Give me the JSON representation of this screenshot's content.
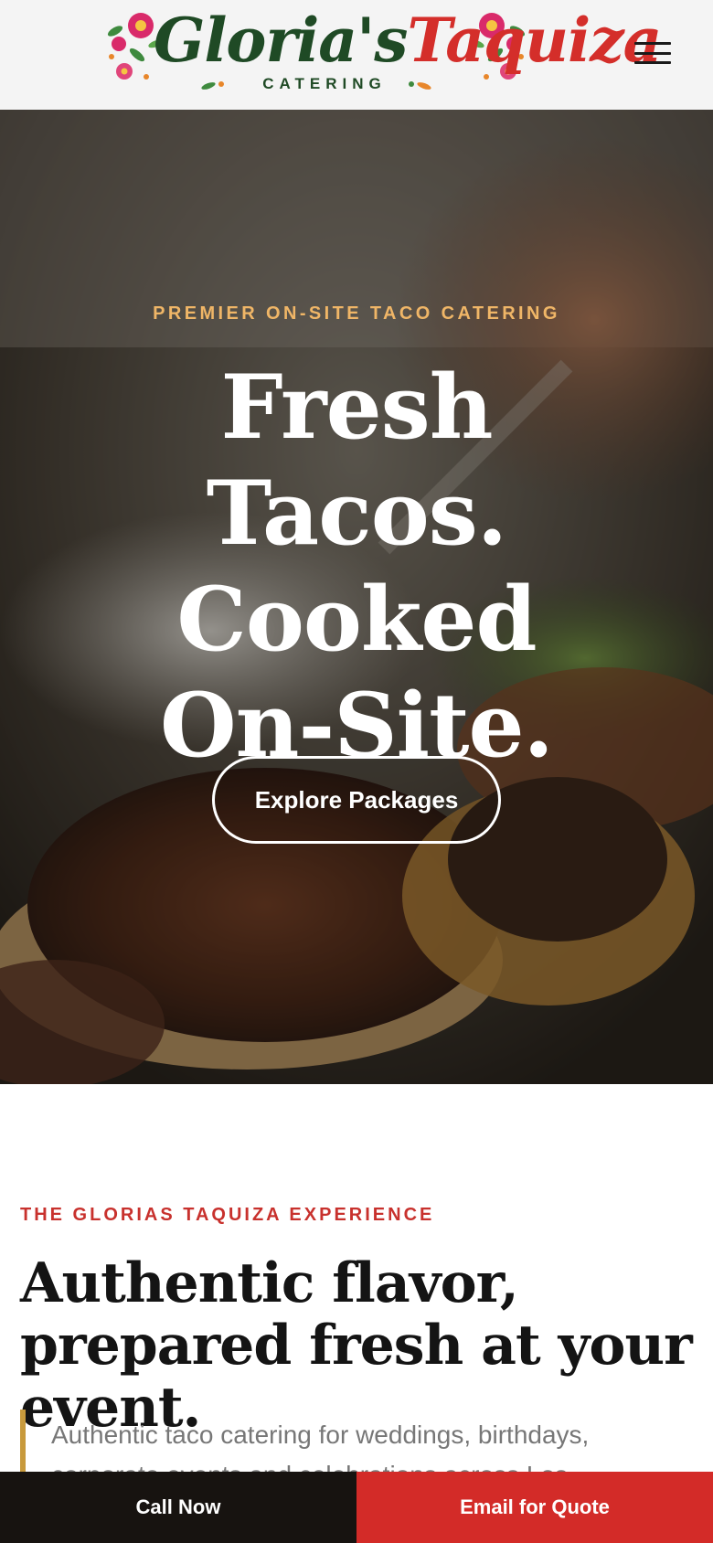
{
  "header": {
    "logo": {
      "name_part1": "Gloria's",
      "name_part2": "Taquiza",
      "subtitle": "CATERING"
    },
    "menu_icon": "hamburger-menu-icon"
  },
  "hero": {
    "eyebrow": "PREMIER ON-SITE TACO CATERING",
    "title": "Fresh Tacos. Cooked On-Site.",
    "cta_label": "Explore Packages"
  },
  "experience": {
    "eyebrow": "THE GLORIAS TAQUIZA EXPERIENCE",
    "heading": "Authentic flavor, prepared fresh at your event.",
    "intro": "Authentic taco catering for weddings, birthdays, corporate events and celebrations across Los"
  },
  "bottom_bar": {
    "call_label": "Call Now",
    "email_label": "Email for Quote"
  },
  "colors": {
    "brand_green": "#1f4a25",
    "brand_red": "#d42e2a",
    "accent_gold": "#f0b667",
    "eyebrow_red": "#c8312d",
    "quote_border": "#c89a3c",
    "bar_dark": "#171310",
    "bar_red": "#d32b28"
  }
}
